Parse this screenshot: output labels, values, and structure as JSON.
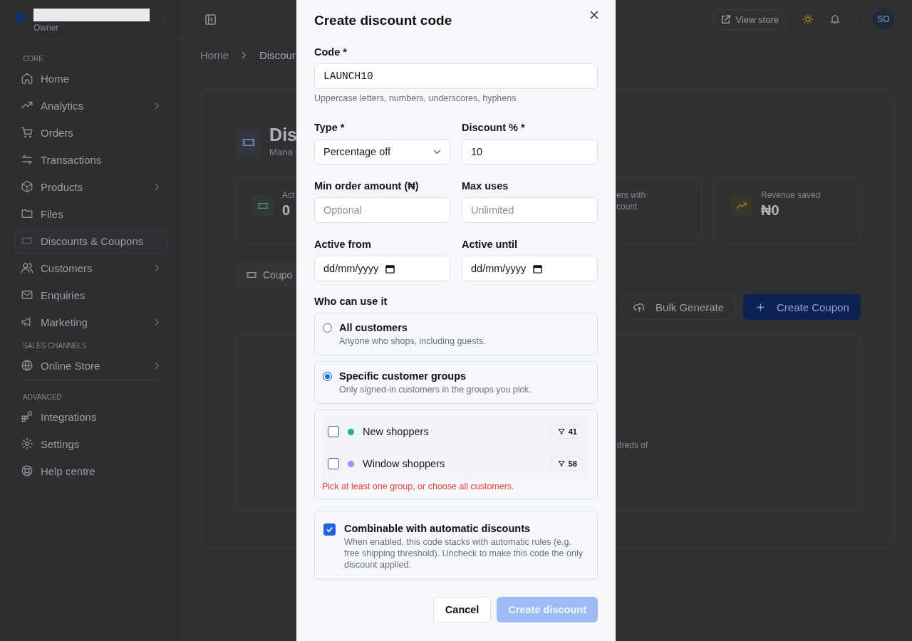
{
  "sidebar": {
    "role": "Owner",
    "sections": [
      {
        "heading": "CORE",
        "items": [
          {
            "label": "Home",
            "has_submenu": false,
            "selected": false
          },
          {
            "label": "Analytics",
            "has_submenu": true,
            "selected": false
          },
          {
            "label": "Orders",
            "has_submenu": false,
            "selected": false
          },
          {
            "label": "Transactions",
            "has_submenu": false,
            "selected": false
          },
          {
            "label": "Products",
            "has_submenu": true,
            "selected": false
          },
          {
            "label": "Files",
            "has_submenu": false,
            "selected": false
          },
          {
            "label": "Discounts & Coupons",
            "has_submenu": false,
            "selected": true
          },
          {
            "label": "Customers",
            "has_submenu": true,
            "selected": false
          },
          {
            "label": "Enquiries",
            "has_submenu": false,
            "selected": false
          },
          {
            "label": "Marketing",
            "has_submenu": true,
            "selected": false
          }
        ]
      },
      {
        "heading": "SALES CHANNELS",
        "items": [
          {
            "label": "Online Store",
            "has_submenu": true,
            "selected": false
          }
        ]
      },
      {
        "heading": "ADVANCED",
        "items": [
          {
            "label": "Integrations",
            "has_submenu": false,
            "selected": false
          },
          {
            "label": "Settings",
            "has_submenu": false,
            "selected": false
          },
          {
            "label": "Help centre",
            "has_submenu": false,
            "selected": false
          }
        ]
      }
    ]
  },
  "topbar": {
    "view_store": "View store",
    "avatar": "SO"
  },
  "breadcrumb": [
    "Home",
    "Discour"
  ],
  "page": {
    "title": "Dis",
    "subtitle": "Mana",
    "stats": [
      {
        "label_lines": [
          "Act"
        ],
        "value": "0"
      },
      {
        "label_lines": [
          "ers with",
          "count"
        ]
      },
      {
        "label_lines": [
          "Revenue saved"
        ],
        "value": "₦0"
      }
    ],
    "tab": "Coupo",
    "bulk_button": "Bulk Generate",
    "create_button": "Create Coupon",
    "empty_text": "dreds of"
  },
  "dialog": {
    "title": "Create discount code",
    "code": {
      "label": "Code *",
      "value": "LAUNCH10",
      "hint": "Uppercase letters, numbers, underscores, hyphens"
    },
    "type": {
      "label": "Type *",
      "value": "Percentage off"
    },
    "discount": {
      "label": "Discount % *",
      "value": "10"
    },
    "min_order": {
      "label": "Min order amount (₦)",
      "placeholder": "Optional"
    },
    "max_uses": {
      "label": "Max uses",
      "placeholder": "Unlimited"
    },
    "active_from": {
      "label": "Active from",
      "value": "dd/mm/yyyy"
    },
    "active_until": {
      "label": "Active until",
      "value": "dd/mm/yyyy"
    },
    "audience": {
      "label": "Who can use it",
      "options": [
        {
          "title": "All customers",
          "description": "Anyone who shops, including guests.",
          "selected": false
        },
        {
          "title": "Specific customer groups",
          "description": "Only signed-in customers in the groups you pick.",
          "selected": true
        }
      ]
    },
    "groups": [
      {
        "name": "New shoppers",
        "color": "#1db57a",
        "count": "41",
        "checked": false
      },
      {
        "name": "Window shoppers",
        "color": "#a78bfa",
        "count": "58",
        "checked": false
      }
    ],
    "groups_error": "Pick at least one group, or choose all customers.",
    "combinable": {
      "title": "Combinable with automatic discounts",
      "description": "When enabled, this code stacks with automatic rules (e.g. free shipping threshold). Uncheck to make this code the only discount applied.",
      "checked": true
    },
    "cancel": "Cancel",
    "submit": "Create discount",
    "submit_disabled": true
  }
}
